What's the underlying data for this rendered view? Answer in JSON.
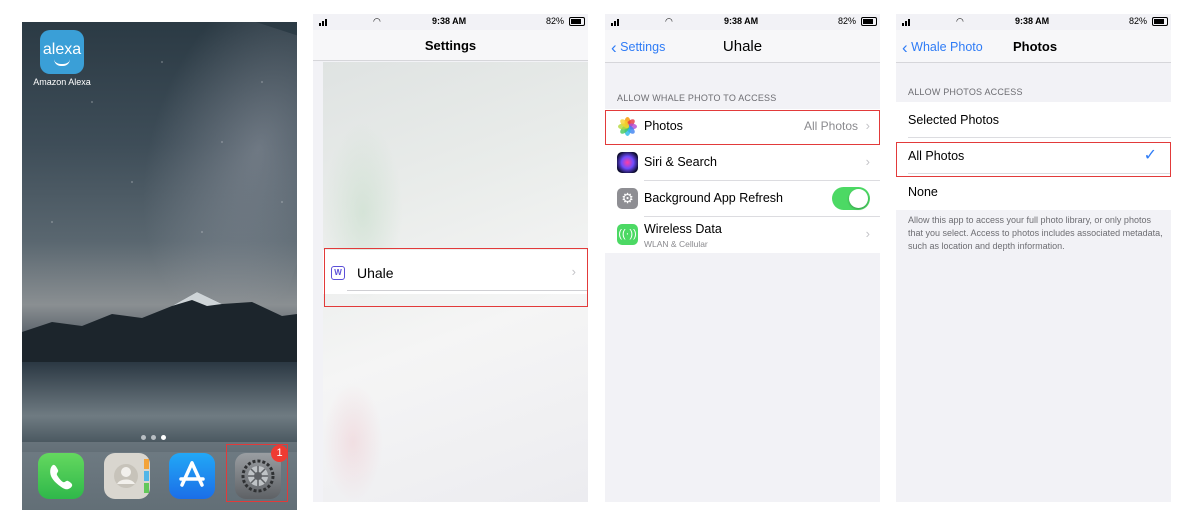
{
  "home": {
    "alexa_icon_text": "alexa",
    "alexa_label": "Amazon Alexa",
    "settings_badge": "1",
    "dock_icons": [
      "phone-icon",
      "contacts-icon",
      "app-store-icon",
      "settings-icon"
    ]
  },
  "status": {
    "time": "9:38 AM",
    "battery": "82%"
  },
  "settings": {
    "title": "Settings",
    "app_row_label": "Uhale"
  },
  "app_settings": {
    "back_label": "Settings",
    "title": "Uhale",
    "section_header": "ALLOW WHALE PHOTO TO ACCESS",
    "rows": [
      {
        "label": "Photos",
        "value": "All Photos",
        "icon": "photos-icon"
      },
      {
        "label": "Siri & Search",
        "icon": "siri-icon"
      },
      {
        "label": "Background App Refresh",
        "icon": "gear-icon",
        "toggle": "on"
      },
      {
        "label": "Wireless Data",
        "sublabel": "WLAN & Cellular",
        "icon": "antenna-icon"
      }
    ]
  },
  "photos_access": {
    "back_label": "Whale Photo",
    "title": "Photos",
    "section_header": "ALLOW PHOTOS ACCESS",
    "options": [
      {
        "label": "Selected Photos"
      },
      {
        "label": "All Photos",
        "selected": true
      },
      {
        "label": "None"
      }
    ],
    "footnote": "Allow this app to access your full photo library, or only photos that you select. Access to photos includes associated metadata, such as location and depth information."
  },
  "colors": {
    "accent": "#2f7cf6",
    "highlight": "#e23a3a",
    "toggle_on": "#4cd964"
  }
}
